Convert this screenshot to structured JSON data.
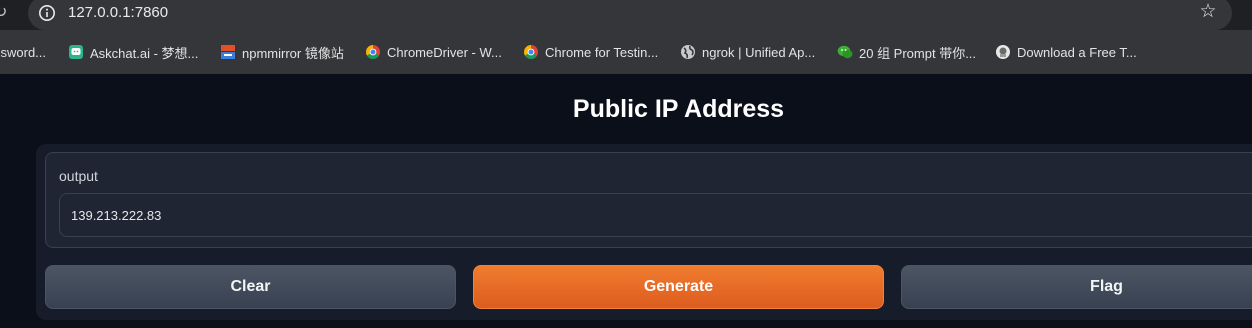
{
  "browser": {
    "url": "127.0.0.1:7860",
    "bookmarks": [
      {
        "label": "ssword...",
        "icon": "key-icon"
      },
      {
        "label": "Askchat.ai - 梦想...",
        "icon": "askchat-icon"
      },
      {
        "label": "npmmirror 镜像站",
        "icon": "npmmirror-icon"
      },
      {
        "label": "ChromeDriver - W...",
        "icon": "chrome-icon"
      },
      {
        "label": "Chrome for Testin...",
        "icon": "chrome-testing-icon"
      },
      {
        "label": "ngrok | Unified Ap...",
        "icon": "globe-icon"
      },
      {
        "label": "20 组 Prompt 带你...",
        "icon": "wechat-icon"
      },
      {
        "label": "Download a Free T...",
        "icon": "download-site-icon"
      }
    ]
  },
  "app": {
    "title": "Public IP Address",
    "output": {
      "label": "output",
      "value": "139.213.222.83"
    },
    "buttons": {
      "clear": "Clear",
      "generate": "Generate",
      "flag": "Flag"
    },
    "colors": {
      "background": "#0b0f19",
      "primary_button": "#ea6a26",
      "secondary_button": "#4b5563"
    }
  }
}
